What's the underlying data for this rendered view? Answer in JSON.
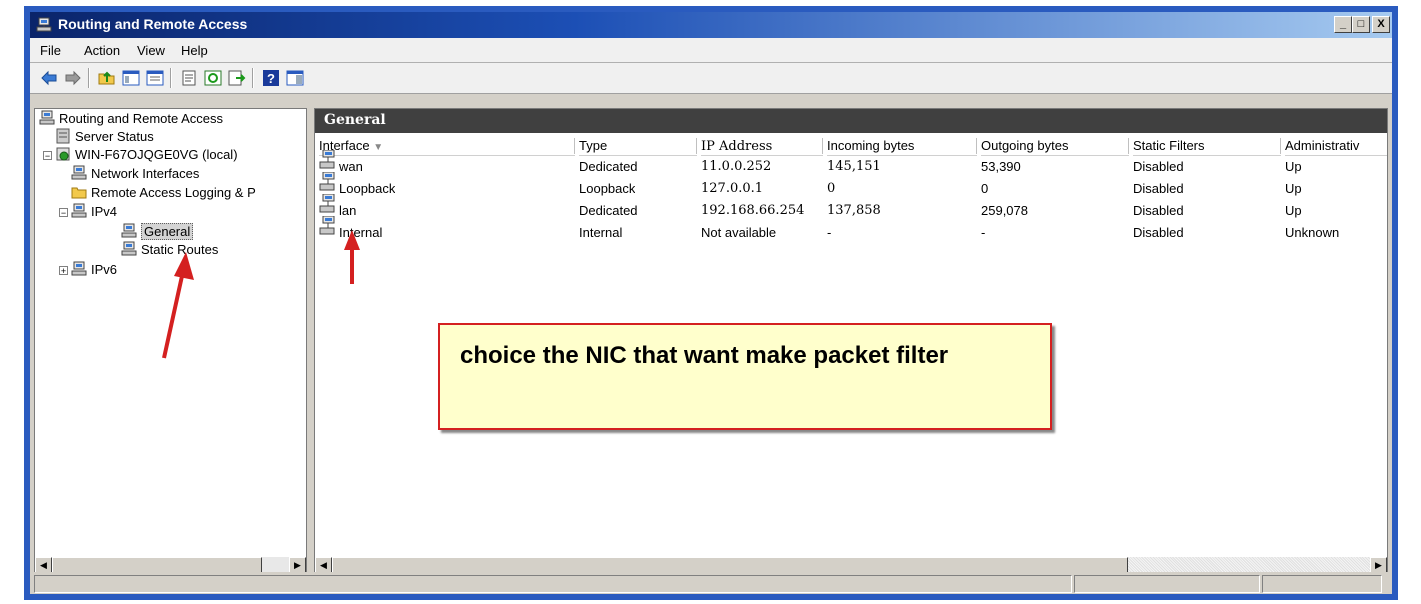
{
  "window": {
    "title": "Routing and Remote Access",
    "min": "_",
    "max": "□",
    "close": "X"
  },
  "menu": [
    "File",
    "Action",
    "View",
    "Help"
  ],
  "tree": {
    "root": "Routing and Remote Access",
    "server_status": "Server Status",
    "server": "WIN-F67OJQGE0VG (local)",
    "network_interfaces": "Network Interfaces",
    "remote_access_logging": "Remote Access Logging & P",
    "ipv4": "IPv4",
    "general": "General",
    "static_routes": "Static Routes",
    "ipv6": "IPv6",
    "minus": "−",
    "plus": "+"
  },
  "panel": {
    "title": "General"
  },
  "columns": [
    "Interface",
    "Type",
    "IP Address",
    "Incoming bytes",
    "Outgoing bytes",
    "Static Filters",
    "Administrativ"
  ],
  "rows": [
    {
      "interface": "wan",
      "type": "Dedicated",
      "ip": "11.0.0.252",
      "in": "145,151",
      "out": "53,390",
      "filters": "Disabled",
      "admin": "Up"
    },
    {
      "interface": "Loopback",
      "type": "Loopback",
      "ip": "127.0.0.1",
      "in": "0",
      "out": "0",
      "filters": "Disabled",
      "admin": "Up"
    },
    {
      "interface": "lan",
      "type": "Dedicated",
      "ip": "192.168.66.254",
      "in": "137,858",
      "out": "259,078",
      "filters": "Disabled",
      "admin": "Up"
    },
    {
      "interface": "Internal",
      "type": "Internal",
      "ip": "Not available",
      "in": "-",
      "out": "-",
      "filters": "Disabled",
      "admin": "Unknown"
    }
  ],
  "callout": {
    "text": "choice the NIC that want make packet filter"
  },
  "colors": {
    "accent": "#d42020",
    "title_bar": "#0a246a",
    "panel_header": "#404040",
    "callout_bg": "#ffffcc"
  },
  "icons": {
    "toolbar": [
      "back-arrow-icon",
      "forward-arrow-icon",
      "up-folder-icon",
      "show-hide-tree-icon",
      "properties-icon",
      "refresh-icon",
      "export-icon",
      "help-icon",
      "show-action-pane-icon"
    ]
  }
}
